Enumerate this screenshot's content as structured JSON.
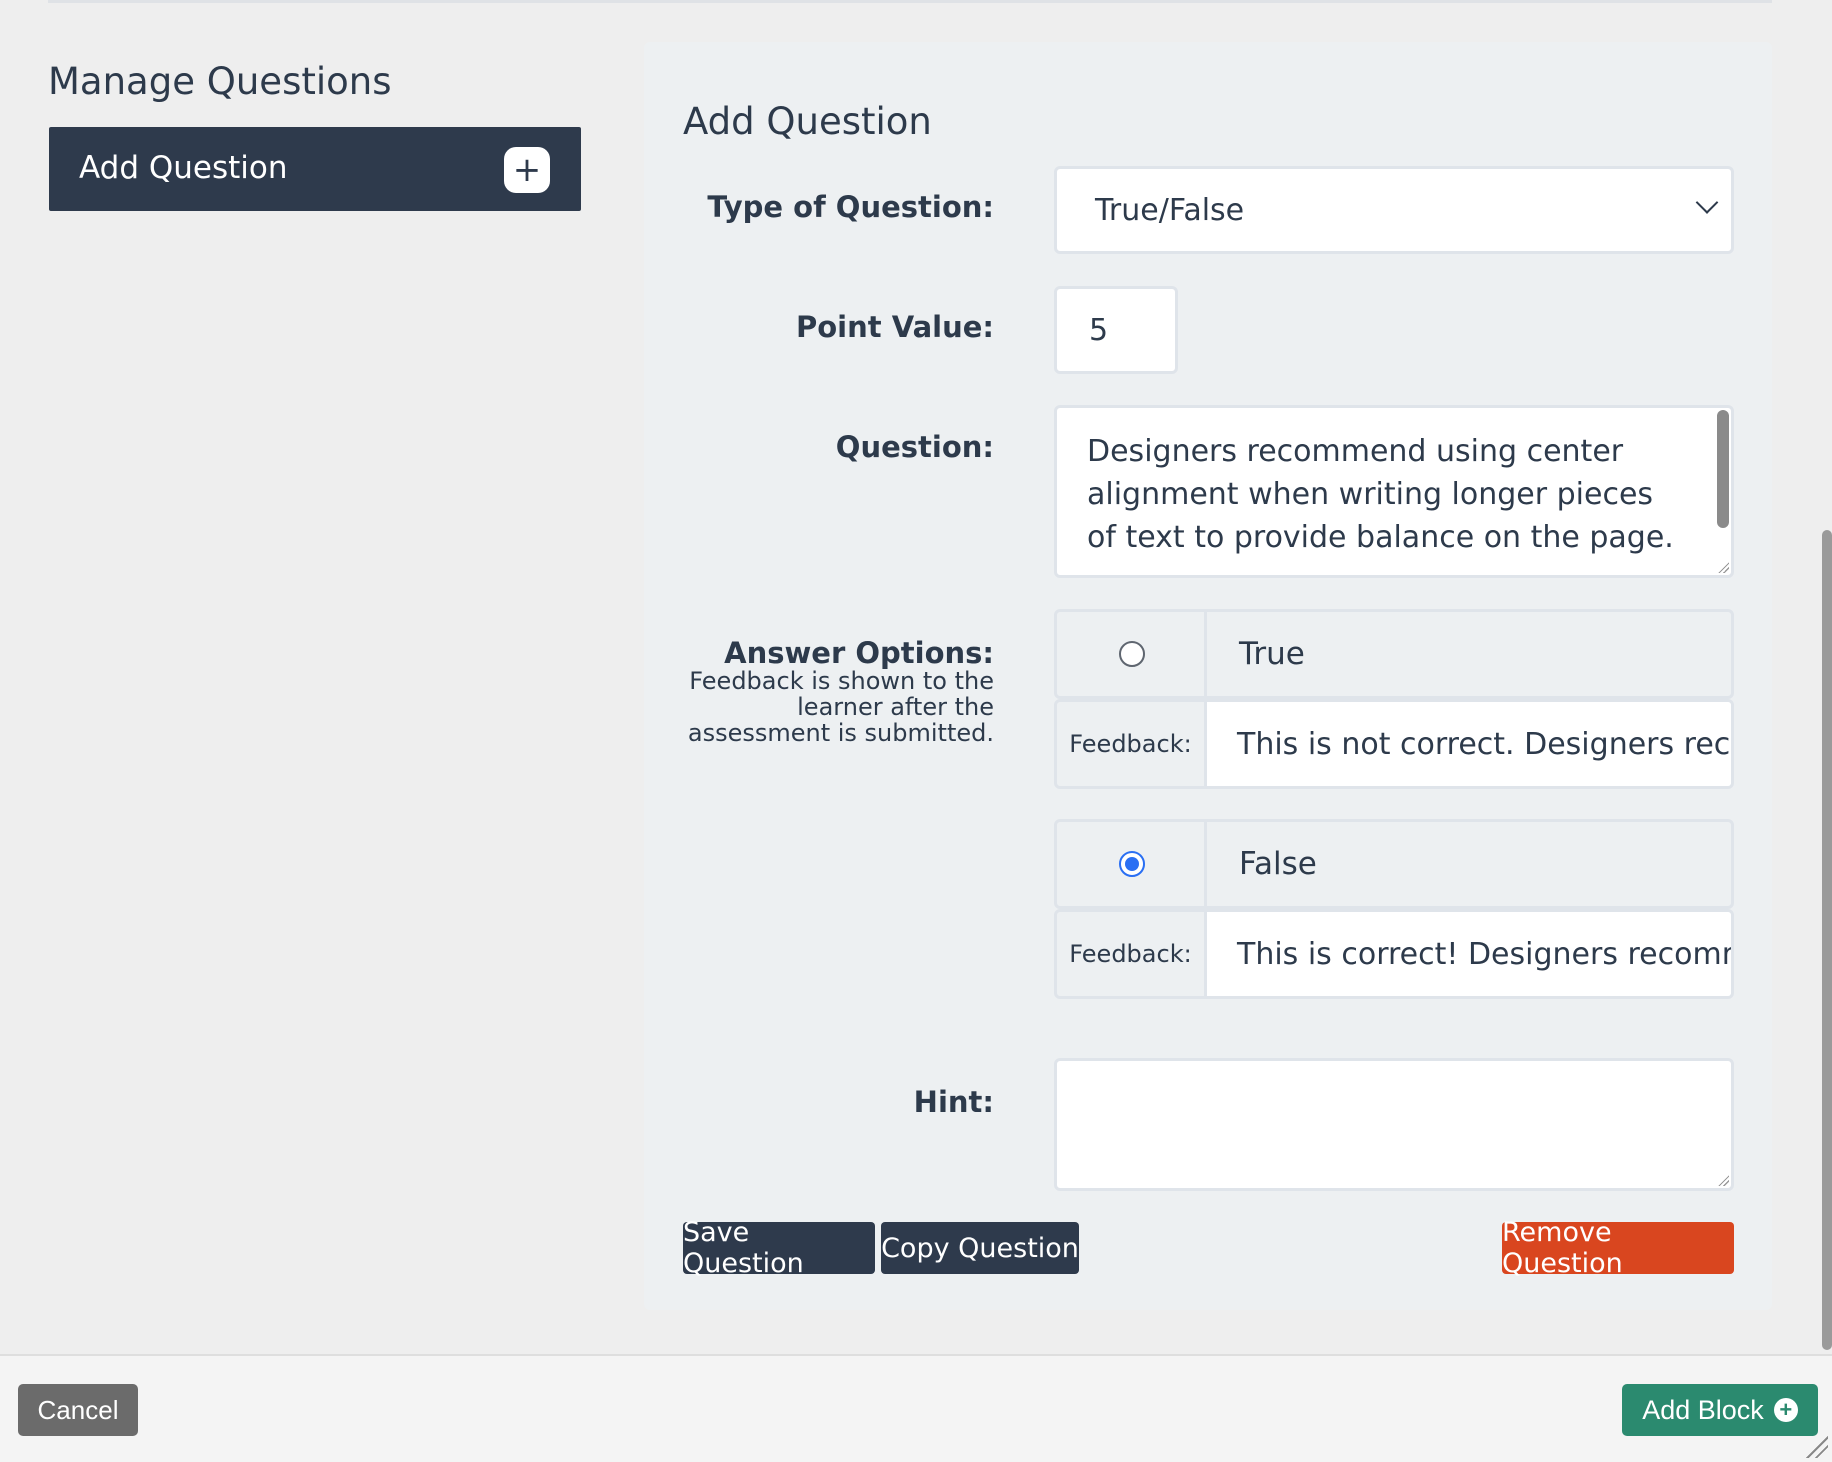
{
  "manage": {
    "title": "Manage Questions",
    "add_question_label": "Add Question",
    "plus_glyph": "+"
  },
  "form": {
    "title": "Add Question",
    "type_label": "Type of Question:",
    "type_value": "True/False",
    "point_label": "Point Value:",
    "point_value": "5",
    "question_label": "Question:",
    "question_text": "Designers recommend using center alignment when writing longer pieces of text to provide balance on the page.",
    "answer_label": "Answer Options:",
    "answer_help": "Feedback is shown to the learner after the assessment is submitted.",
    "options": [
      {
        "label": "True",
        "checked": false,
        "feedback_label": "Feedback:",
        "feedback": "This is not correct. Designers recom"
      },
      {
        "label": "False",
        "checked": true,
        "feedback_label": "Feedback:",
        "feedback": "This is correct! Designers recomme"
      }
    ],
    "hint_label": "Hint:",
    "hint_value": ""
  },
  "actions": {
    "save": "Save Question",
    "copy": "Copy Question",
    "remove": "Remove Question"
  },
  "footer": {
    "cancel": "Cancel",
    "add_block": "Add Block",
    "add_block_icon": "+"
  },
  "colors": {
    "dark": "#2e3a4c",
    "danger": "#d9461f",
    "success": "#2b8a6f",
    "radio_selected": "#2a6ff3"
  }
}
